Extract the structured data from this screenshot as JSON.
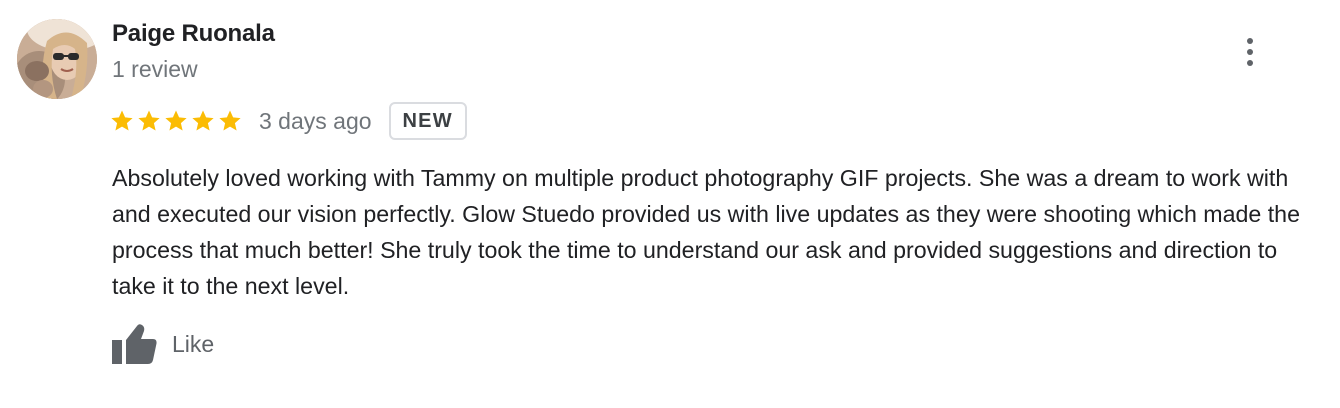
{
  "reviewer": {
    "name": "Paige Ruonala",
    "review_count": "1 review"
  },
  "rating": {
    "stars": 5,
    "max_stars": 5,
    "star_color": "#fbbc04"
  },
  "time_ago": "3 days ago",
  "badge": "NEW",
  "review_text": "Absolutely loved working with Tammy on multiple product photography GIF projects. She was a dream to work with and executed our vision perfectly. Glow Stuedo provided us with live updates as they were shooting which made the process that much better! She truly took the time to understand our ask and provided suggestions and direction to take it to the next level.",
  "actions": {
    "like_label": "Like",
    "like_icon": "thumbs-up-icon",
    "more_icon": "more-vert-icon"
  }
}
